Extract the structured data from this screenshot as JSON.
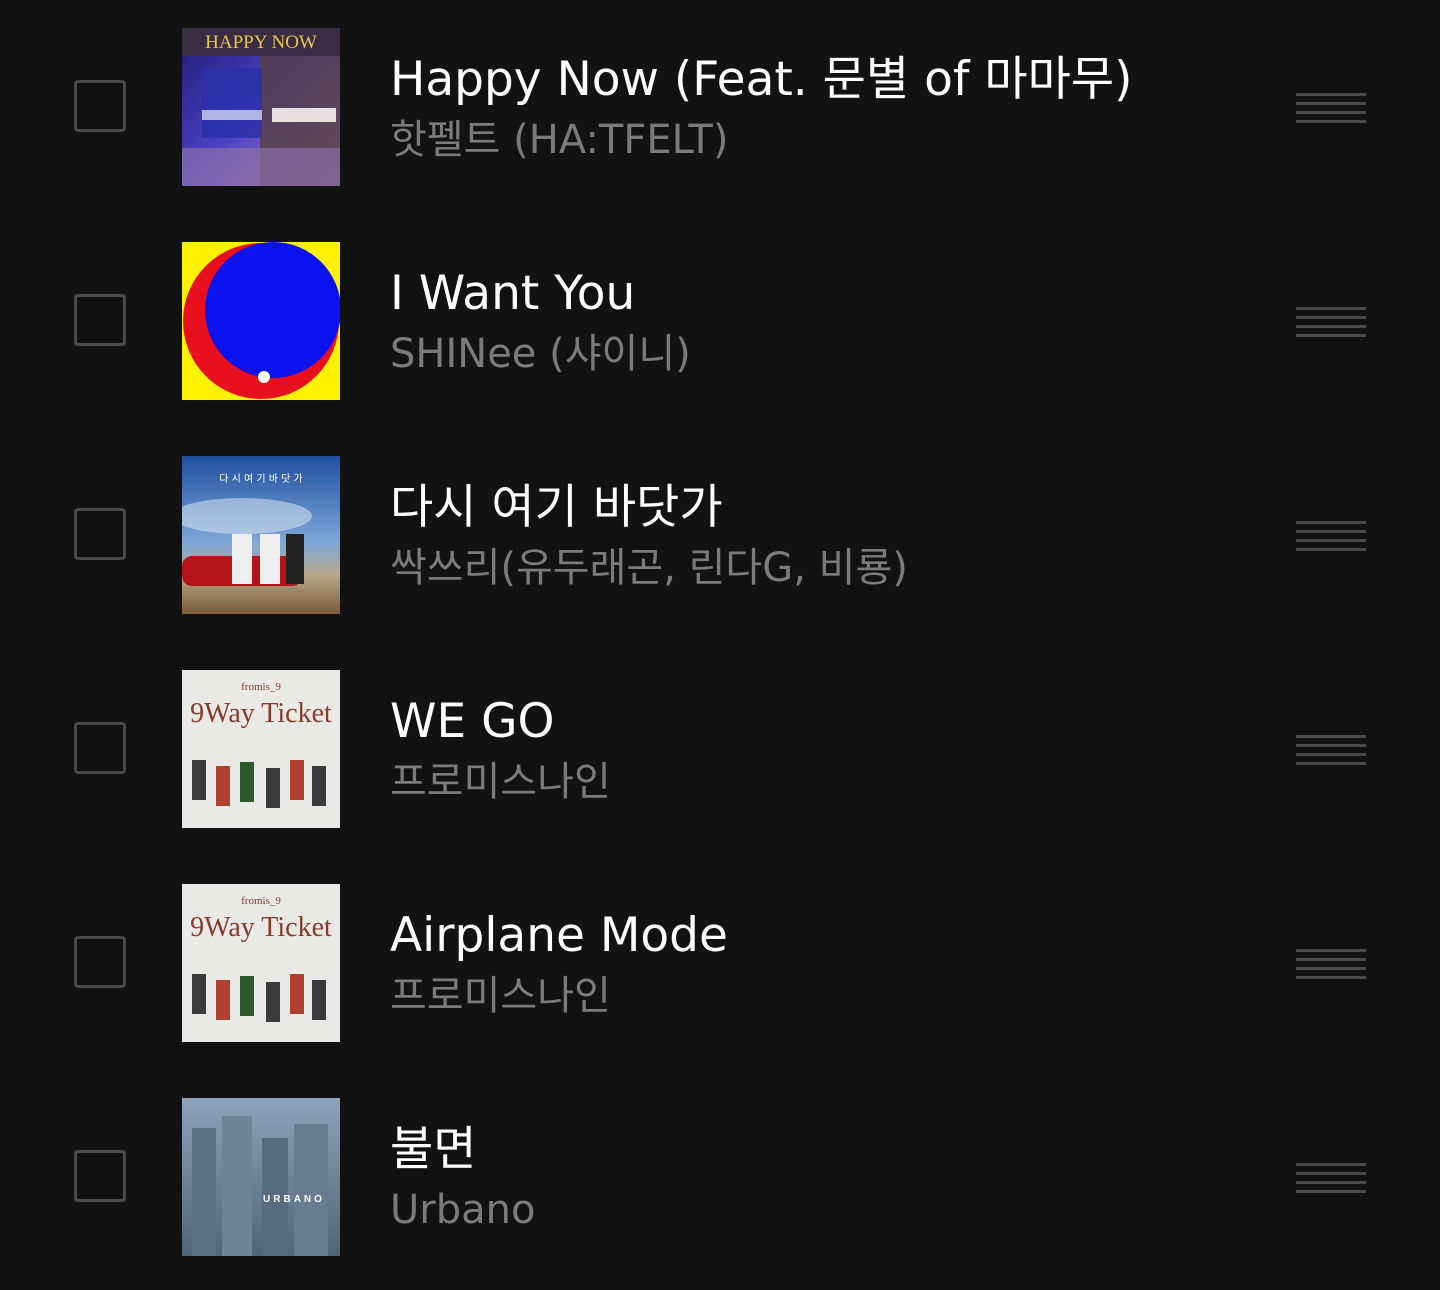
{
  "songs": [
    {
      "title": "Happy Now (Feat. 문별 of 마마무)",
      "artist": "핫펠트 (HA:TFELT)",
      "art_text": "HAPPY NOW"
    },
    {
      "title": "I Want You",
      "artist": "SHINee (샤이니)"
    },
    {
      "title": "다시 여기 바닷가",
      "artist": "싹쓰리(유두래곤, 린다G, 비룡)",
      "art_text": "다 시 여 기 바 닷 가"
    },
    {
      "title": "WE GO",
      "artist": "프로미스나인",
      "art_text_top": "fromis_9",
      "art_text_main": "9Way Ticket"
    },
    {
      "title": "Airplane Mode",
      "artist": "프로미스나인",
      "art_text_top": "fromis_9",
      "art_text_main": "9Way Ticket"
    },
    {
      "title": "불면",
      "artist": "Urbano",
      "art_text": "URBANO"
    }
  ],
  "colors": {
    "background": "#121212",
    "title": "#ffffff",
    "artist": "#7b7b7b",
    "control": "#4a4a4a"
  }
}
